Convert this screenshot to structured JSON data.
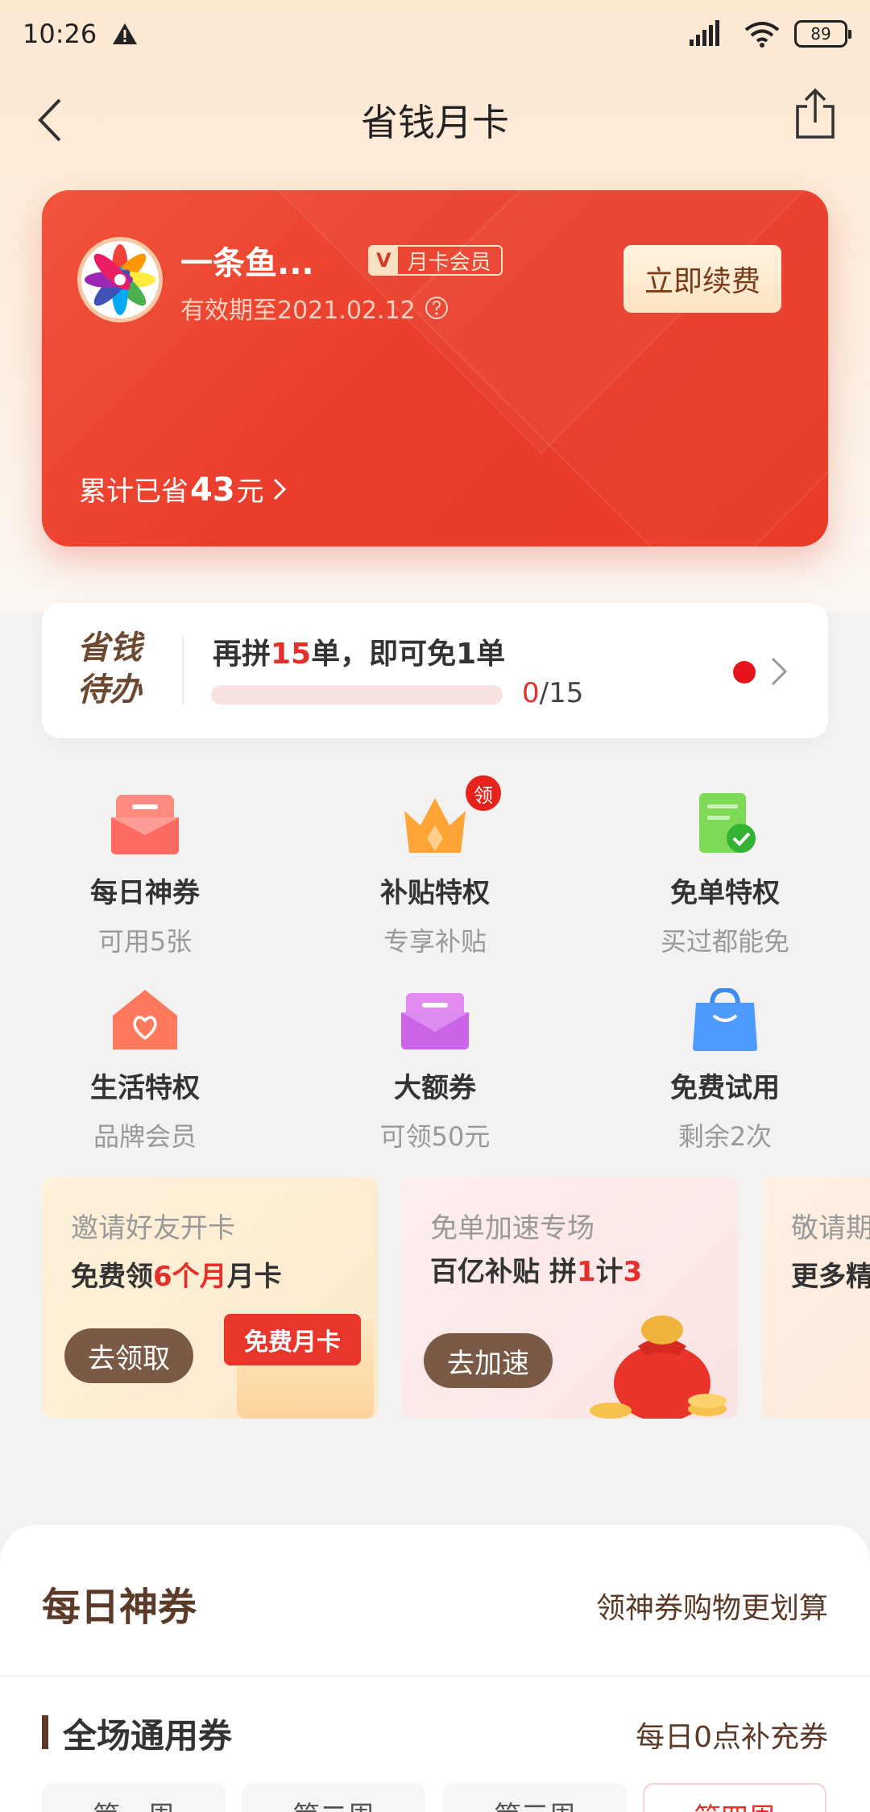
{
  "status": {
    "time": "10:26",
    "battery": "89"
  },
  "nav": {
    "title": "省钱月卡"
  },
  "card": {
    "username": "一条鱼...",
    "badge_v": "V",
    "badge_label": "月卡会员",
    "expiry": "有效期至2021.02.12",
    "renew_label": "立即续费",
    "saved_prefix": "累计已省",
    "saved_amount": "43",
    "saved_suffix": "元"
  },
  "todo": {
    "logo_line1": "省钱",
    "logo_line2": "待办",
    "text_prefix": "再拼",
    "text_count": "15",
    "text_suffix": "单，即可免1单",
    "progress_current": "0",
    "progress_total": "/15",
    "progress_fraction": 0
  },
  "benefits": [
    {
      "title": "每日神券",
      "sub": "可用5张",
      "icon": "coupon-box-icon"
    },
    {
      "title": "补贴特权",
      "sub": "专享补贴",
      "icon": "crown-icon",
      "badge": "领"
    },
    {
      "title": "免单特权",
      "sub": "买过都能免",
      "icon": "free-order-icon"
    },
    {
      "title": "生活特权",
      "sub": "品牌会员",
      "icon": "house-heart-icon"
    },
    {
      "title": "大额券",
      "sub": "可领50元",
      "icon": "envelope-icon"
    },
    {
      "title": "免费试用",
      "sub": "剩余2次",
      "icon": "shopping-bag-icon"
    }
  ],
  "promos": [
    {
      "kicker": "邀请好友开卡",
      "headline_a": "免费领",
      "headline_b": "6个月",
      "headline_c": "月卡",
      "button": "去领取",
      "tag": "免费月卡"
    },
    {
      "kicker": "免单加速专场",
      "headline_a": "百亿补贴 拼",
      "headline_b": "1",
      "headline_c": "计",
      "headline_d": "3",
      "button": "去加速"
    },
    {
      "kicker": "敬请期",
      "headline_a": "更多精"
    }
  ],
  "coupons": {
    "title": "每日神券",
    "desc": "领神券购物更划算",
    "sub_title": "全场通用券",
    "sub_desc": "每日0点补充券",
    "tabs": [
      "第一周",
      "第二周",
      "第三周",
      "第四周"
    ],
    "active_tab": 3
  },
  "colors": {
    "accent": "#e3302a",
    "card_red": "#ea3c2b",
    "brown": "#5b3a28"
  }
}
